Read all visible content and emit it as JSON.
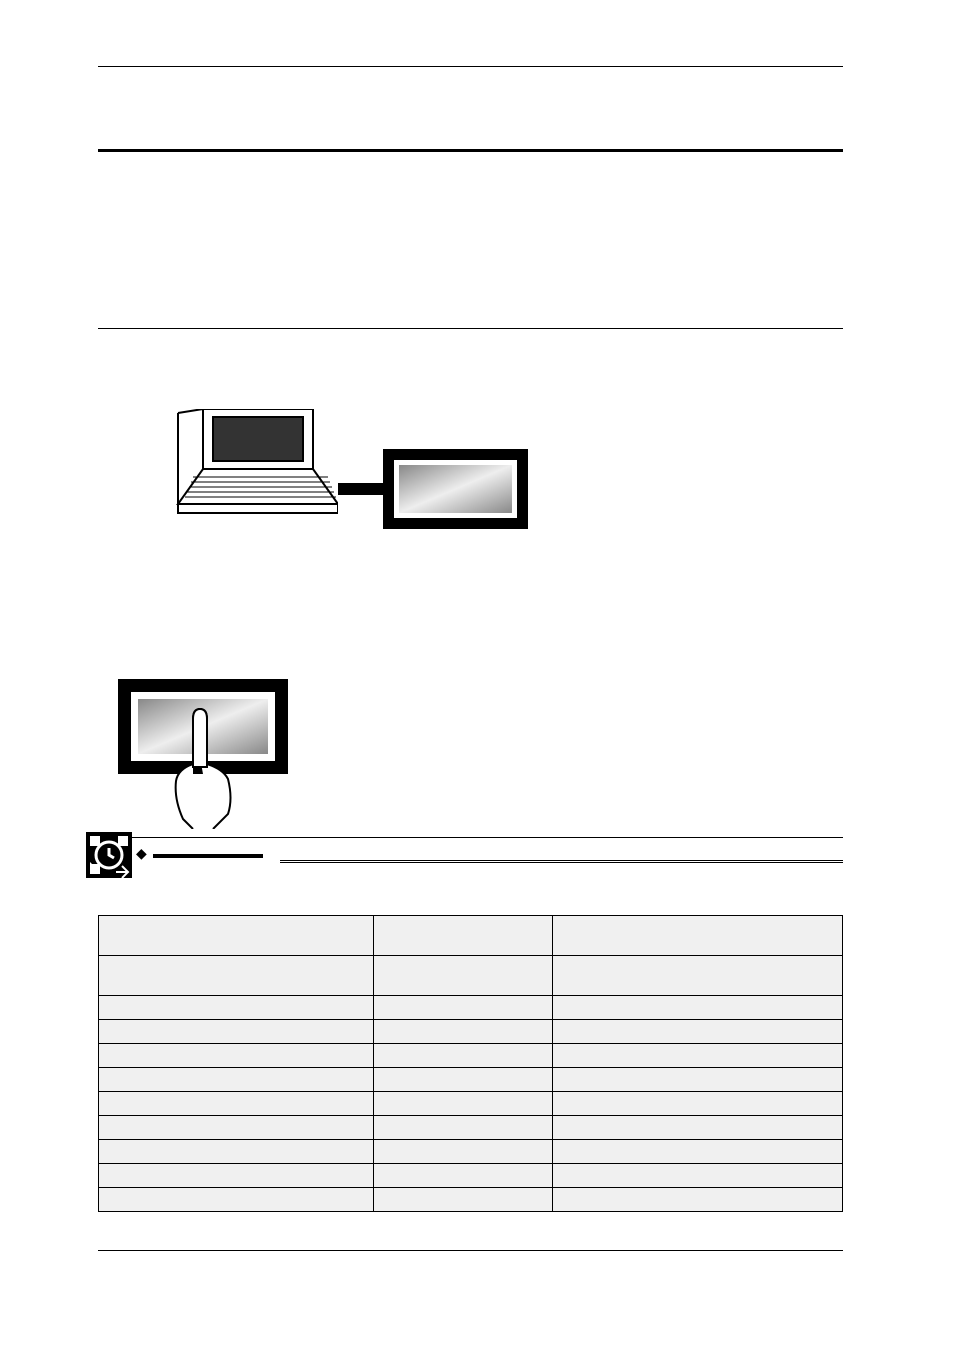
{
  "header": {},
  "section1": {},
  "section2": {},
  "keypoint": {
    "diamond": "◆",
    "label": ""
  },
  "table": {
    "headers": [
      "",
      "",
      ""
    ],
    "rows": [
      [
        "",
        "",
        ""
      ],
      [
        "",
        "",
        ""
      ],
      [
        "",
        "",
        ""
      ],
      [
        "",
        "",
        ""
      ],
      [
        "",
        "",
        ""
      ],
      [
        "",
        "",
        ""
      ],
      [
        "",
        "",
        ""
      ],
      [
        "",
        "",
        ""
      ],
      [
        "",
        "",
        ""
      ],
      [
        "",
        "",
        ""
      ]
    ]
  }
}
